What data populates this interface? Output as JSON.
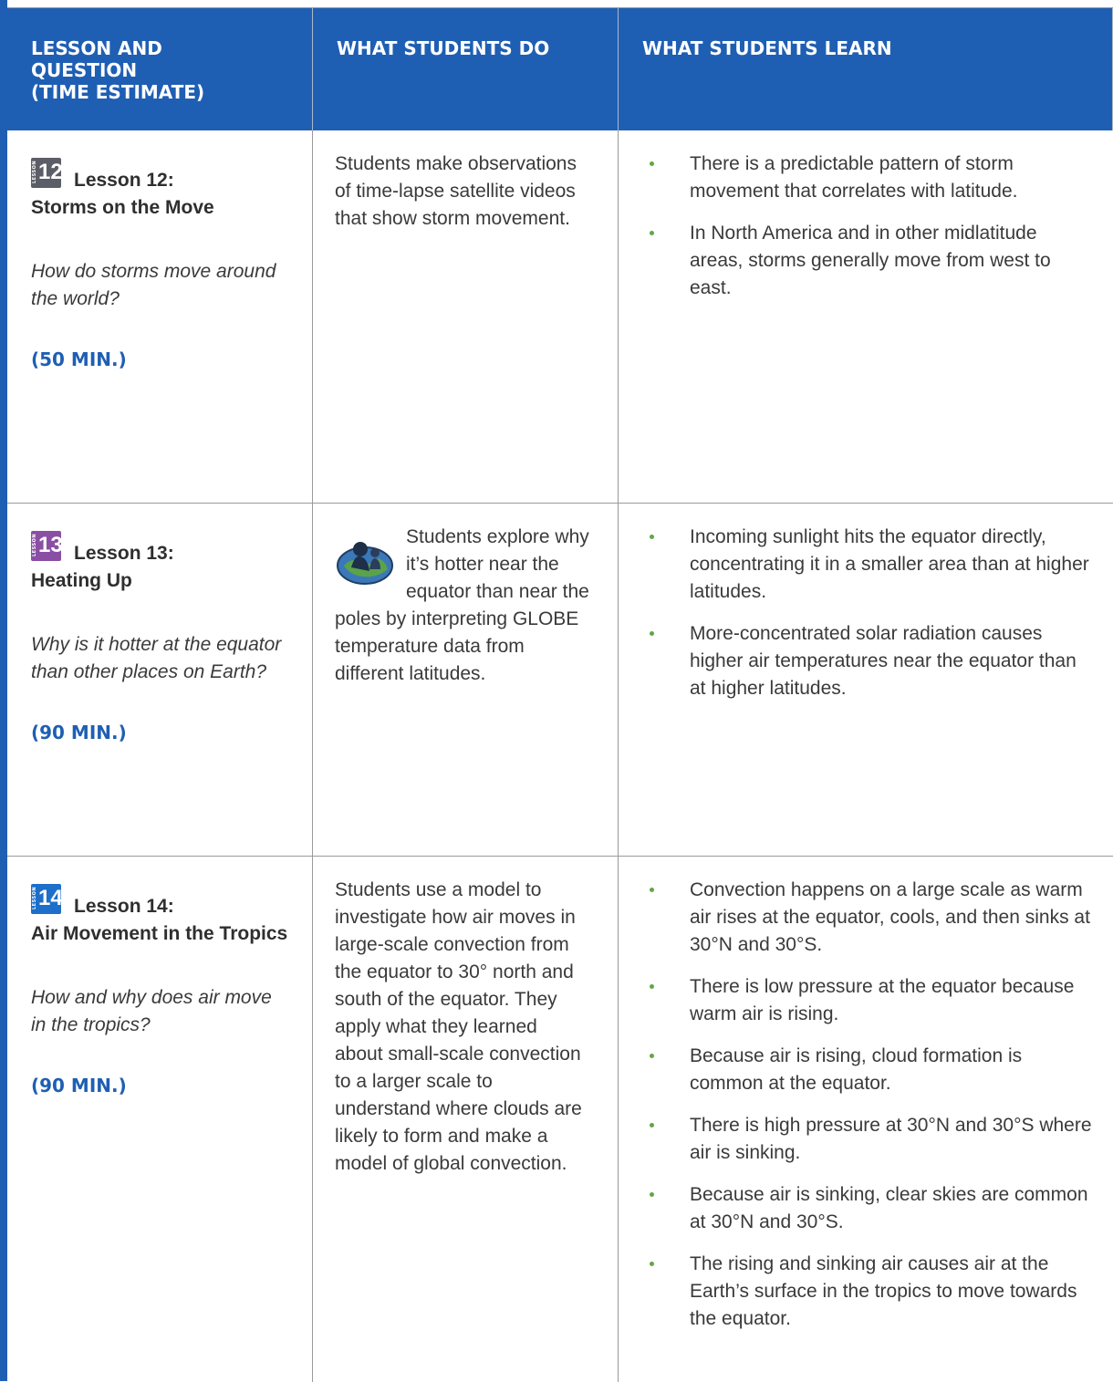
{
  "header": {
    "col1_lines": [
      "LESSON AND",
      "QUESTION",
      "(TIME ESTIMATE)"
    ],
    "col2": "WHAT STUDENTS DO",
    "col3": "WHAT STUDENTS LEARN"
  },
  "badge_word": "LESSON",
  "rows": [
    {
      "badge_number": "12",
      "badge_color": "#5b5e66",
      "lesson_label": "Lesson 12:",
      "lesson_title": "Storms on the Move",
      "question": "How do storms move around the world?",
      "time": "(50 MIN.)",
      "students_do": "Students make observations of time-lapse satellite videos that show storm movement.",
      "learn": [
        "There is a predictable pattern of storm movement that correlates with latitude.",
        "In North America and in other midlatitude areas, storms generally move from west to east."
      ]
    },
    {
      "badge_number": "13",
      "badge_color": "#8a4fa4",
      "lesson_label": "Lesson 13:",
      "lesson_title": "Heating Up",
      "question": "Why is it hotter at the equator than other places on Earth?",
      "time": "(90 MIN.)",
      "students_do": "Students explore why it’s hotter near the equator than near the poles by interpreting GLOBE temperature data from different latitudes.",
      "learn": [
        "Incoming sunlight hits the equator directly, concentrating it in a smaller area than at higher latitudes.",
        "More-concentrated solar radiation causes higher air temperatures near the equator than at higher latitudes."
      ]
    },
    {
      "badge_number": "14",
      "badge_color": "#1d6fc9",
      "lesson_label": "Lesson 14:",
      "lesson_title": "Air Movement in the Tropics",
      "question": "How and why does air move in the tropics?",
      "time": "(90 MIN.)",
      "students_do": "Students use a model to investigate how air moves in large-scale convection from the equator to 30° north and south of the equator. They apply what they learned about small-scale convection to a larger scale to understand where clouds are likely to form and make a model of global convection.",
      "learn": [
        "Convection happens on a large scale as warm air rises at the equator, cools, and then sinks at 30°N and 30°S.",
        "There is low pressure at the equator because warm air is rising.",
        "Because air is rising, cloud formation is common at the equator.",
        "There is high pressure at 30°N and 30°S where air is sinking.",
        "Because air is sinking, clear skies are common at 30°N and 30°S.",
        "The rising and sinking air causes air at the Earth’s surface in the tropics to move towards the equator."
      ]
    }
  ]
}
